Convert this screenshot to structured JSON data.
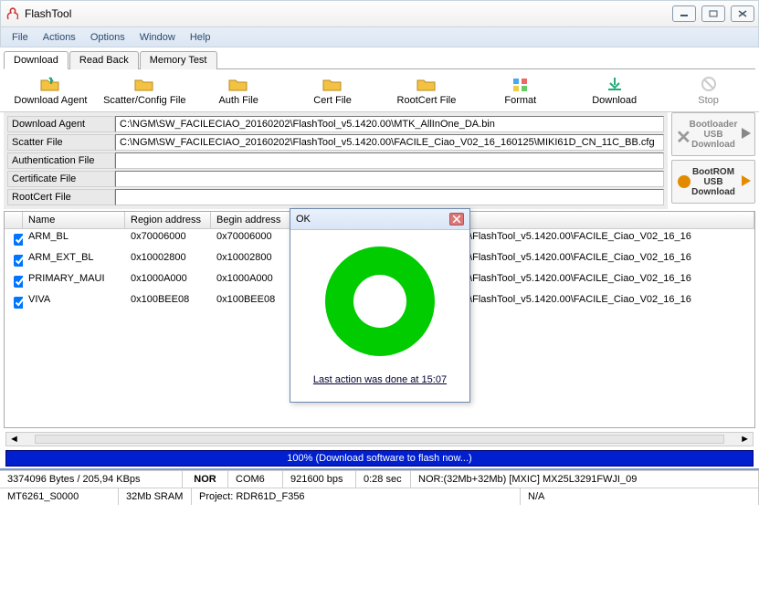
{
  "window": {
    "title": "FlashTool"
  },
  "menu": {
    "items": [
      "File",
      "Actions",
      "Options",
      "Window",
      "Help"
    ]
  },
  "tabs": {
    "items": [
      "Download",
      "Read Back",
      "Memory Test"
    ],
    "active": 0
  },
  "toolbar": {
    "download_agent": "Download Agent",
    "scatter_config": "Scatter/Config File",
    "auth_file": "Auth File",
    "cert_file": "Cert File",
    "rootcert_file": "RootCert File",
    "format": "Format",
    "download": "Download",
    "stop": "Stop"
  },
  "fields": {
    "download_agent_label": "Download Agent",
    "download_agent_value": "C:\\NGM\\SW_FACILECIAO_20160202\\FlashTool_v5.1420.00\\MTK_AllInOne_DA.bin",
    "scatter_label": "Scatter File",
    "scatter_value": "C:\\NGM\\SW_FACILECIAO_20160202\\FlashTool_v5.1420.00\\FACILE_Ciao_V02_16_160125\\MIKI61D_CN_11C_BB.cfg",
    "auth_label": "Authentication File",
    "auth_value": "",
    "cert_label": "Certificate File",
    "cert_value": "",
    "rootcert_label": "RootCert File",
    "rootcert_value": ""
  },
  "rightbtns": {
    "bootloader": "Bootloader USB Download",
    "bootrom": "BootROM USB Download"
  },
  "table": {
    "headers": {
      "name": "Name",
      "region": "Region address",
      "begin": "Begin address"
    },
    "rows": [
      {
        "chk": true,
        "name": "ARM_BL",
        "region": "0x70006000",
        "begin": "0x70006000",
        "loc": "_20160202\\FlashTool_v5.1420.00\\FACILE_Ciao_V02_16_16"
      },
      {
        "chk": true,
        "name": "ARM_EXT_BL",
        "region": "0x10002800",
        "begin": "0x10002800",
        "loc": "_20160202\\FlashTool_v5.1420.00\\FACILE_Ciao_V02_16_16"
      },
      {
        "chk": true,
        "name": "PRIMARY_MAUI",
        "region": "0x1000A000",
        "begin": "0x1000A000",
        "loc": "_20160202\\FlashTool_v5.1420.00\\FACILE_Ciao_V02_16_16"
      },
      {
        "chk": true,
        "name": "VIVA",
        "region": "0x100BEE08",
        "begin": "0x100BEE08",
        "loc": "_20160202\\FlashTool_v5.1420.00\\FACILE_Ciao_V02_16_16"
      }
    ]
  },
  "progress": {
    "text": "100% (Download software to flash now...)"
  },
  "status": {
    "row1": {
      "bytes": "3374096 Bytes / 205,94 KBps",
      "nor": "NOR",
      "port": "COM6",
      "bps": "921600 bps",
      "time": "0:28 sec",
      "chip": "NOR:(32Mb+32Mb) [MXIC] MX25L3291FWJI_09"
    },
    "row2": {
      "mcu": "MT6261_S0000",
      "ram": "32Mb SRAM",
      "project": "Project: RDR61D_F356",
      "na": "N/A"
    }
  },
  "dialog": {
    "title": "OK",
    "message": "Last action was done at 15:07"
  },
  "colors": {
    "green": "#00cc00",
    "progressbg": "#0020d0"
  }
}
